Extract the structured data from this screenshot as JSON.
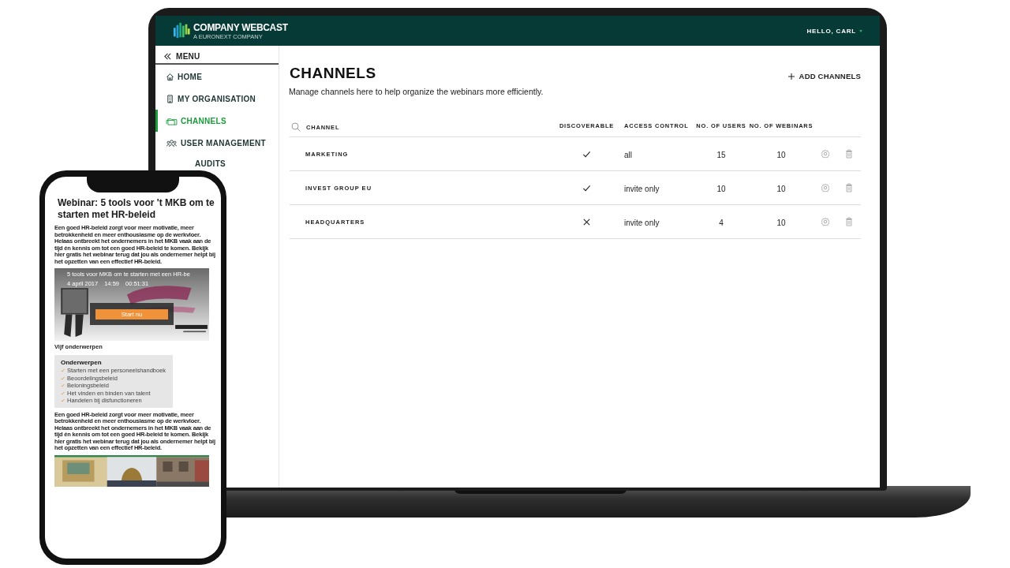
{
  "laptop": {
    "brand": {
      "name": "COMPANY WEBCAST",
      "tagline": "A EURONEXT COMPANY"
    },
    "user_menu": "HELLO, CARL",
    "menu_label": "MENU",
    "sidebar": {
      "items": [
        {
          "label": "HOME",
          "kind": "home",
          "selected": false
        },
        {
          "label": "MY ORGANISATION",
          "kind": "building",
          "selected": false
        },
        {
          "label": "CHANNELS",
          "kind": "folder",
          "selected": true
        },
        {
          "label": "USER MANAGEMENT",
          "kind": "users",
          "selected": false
        },
        {
          "label": "AUDITS",
          "kind": "audits",
          "selected": false
        }
      ]
    },
    "page": {
      "title": "CHANNELS",
      "subtitle": "Manage channels here to help organize the webinars more efficiently.",
      "add_button": "ADD CHANNELS"
    },
    "table": {
      "columns": [
        "CHANNEL",
        "DISCOVERABLE",
        "ACCESS CONTROL",
        "NO. OF USERS",
        "NO. OF WEBINARS"
      ],
      "rows": [
        {
          "channel": "MARKETING",
          "discoverable": true,
          "access": "all",
          "users": "15",
          "webinars": "10"
        },
        {
          "channel": "INVEST GROUP EU",
          "discoverable": true,
          "access": "invite only",
          "users": "10",
          "webinars": "10"
        },
        {
          "channel": "HEADQUARTERS",
          "discoverable": false,
          "access": "invite only",
          "users": "4",
          "webinars": "10"
        }
      ]
    }
  },
  "phone": {
    "title": "Webinar: 5 tools voor 't MKB om te starten met HR-beleid",
    "intro": "Een goed HR-beleid zorgt voor meer motivatie, meer betrokkenheid en meer enthousiasme op de werkvloer. Helaas ontbreekt het ondernemers in het MKB vaak aan de tijd én kennis om tot een goed HR-beleid te komen. Bekijk hier gratis het webinar terug dat jou als ondernemer helpt bij het opzetten van een effectief HR-beleid.",
    "video": {
      "title": "5 tools voor MKB om te starten met een HR-be",
      "date": "4 april 2017",
      "time": "14:59",
      "duration": "00:51:31",
      "button": "Start nu"
    },
    "section_label": "Vijf onderwerpen",
    "topics": {
      "heading": "Onderwerpen",
      "items": [
        "Starten met een personeelshandboek",
        "Beoordelingsbeleid",
        "Beloningsbeleid",
        "Het vinden en binden van talent",
        "Handelen bij disfunctioneren"
      ]
    },
    "outro": "Een goed HR-beleid zorgt voor meer motivatie, meer betrokkenheid en meer enthousiasme op de werkvloer. Helaas ontbreekt het ondernemers in het MKB vaak aan de tijd én kennis om tot een goed HR-beleid te komen. Bekijk hier gratis het webinar terug dat jou als ondernemer helpt bij het opzetten van een effectief HR-beleid."
  }
}
